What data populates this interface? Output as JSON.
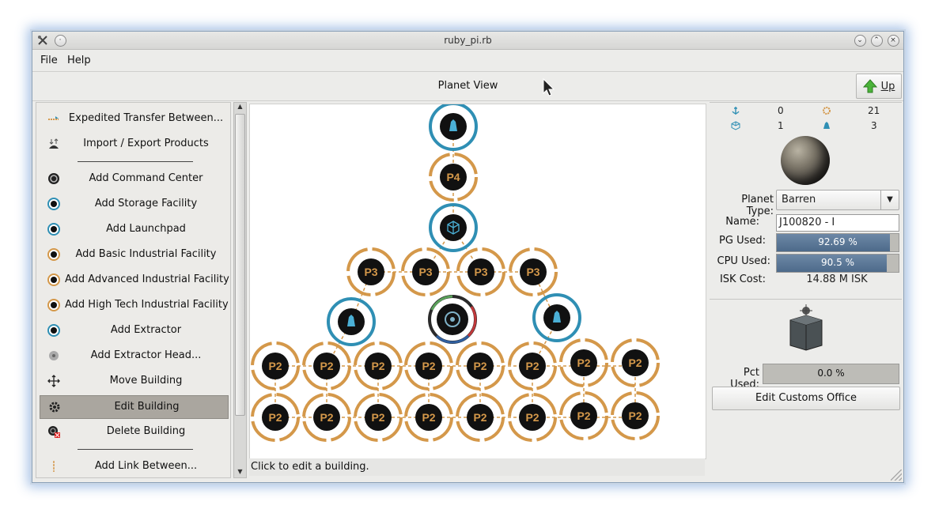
{
  "window": {
    "title": "ruby_pi.rb"
  },
  "menu": {
    "file": "File",
    "help": "Help"
  },
  "view": {
    "title": "Planet View",
    "up_label": "Up"
  },
  "tools": [
    {
      "label": "Expedited Transfer Between...",
      "icon": "transfer-icon"
    },
    {
      "label": "Import / Export Products",
      "icon": "import-export-icon"
    },
    {
      "label": "Add Command Center",
      "icon": "command-center-icon"
    },
    {
      "label": "Add Storage Facility",
      "icon": "storage-icon"
    },
    {
      "label": "Add Launchpad",
      "icon": "launchpad-icon"
    },
    {
      "label": "Add Basic Industrial Facility",
      "icon": "basic-industry-icon"
    },
    {
      "label": "Add Advanced Industrial Facility",
      "icon": "advanced-industry-icon"
    },
    {
      "label": "Add High Tech Industrial Facility",
      "icon": "hightech-industry-icon"
    },
    {
      "label": "Add Extractor",
      "icon": "extractor-icon"
    },
    {
      "label": "Add Extractor Head...",
      "icon": "extractor-head-icon"
    },
    {
      "label": "Move Building",
      "icon": "move-icon"
    },
    {
      "label": "Edit Building",
      "icon": "edit-gear-icon"
    },
    {
      "label": "Delete Building",
      "icon": "delete-icon"
    },
    {
      "label": "Add Link Between...",
      "icon": "link-icon"
    }
  ],
  "status_text": "Click to edit a building.",
  "stats": {
    "launchpads": "0",
    "factories": "21",
    "storage": "1",
    "extractors": "3"
  },
  "planet": {
    "type_label": "Planet Type:",
    "type_value": "Barren",
    "name_label": "Name:",
    "name_value": "J100820 - I",
    "pg_label": "PG Used:",
    "pg_value": "92.69 %",
    "pg_fraction": 0.9269,
    "cpu_label": "CPU Used:",
    "cpu_value": "90.5 %",
    "cpu_fraction": 0.905,
    "isk_label": "ISK Cost:",
    "isk_value": "14.88 M ISK"
  },
  "customs": {
    "pct_label": "Pct Used:",
    "pct_value": "0.0 %",
    "button": "Edit Customs Office"
  },
  "buildings": {
    "top_launchpad": "",
    "p4": "P4",
    "storage": "",
    "p3_row": [
      "P3",
      "P3",
      "P3",
      "P3"
    ],
    "left_launchpad": "",
    "command_center": "",
    "right_launchpad": "",
    "p2_row1": [
      "P2",
      "P2",
      "P2",
      "P2",
      "P2",
      "P2",
      "P2",
      "P2"
    ],
    "p2_row2": [
      "P2",
      "P2",
      "P2",
      "P2",
      "P2",
      "P2",
      "P2",
      "P2"
    ]
  },
  "colors": {
    "orange": "#d4984a",
    "blue": "#2f8fb4",
    "selection": "#aaa69f",
    "bar": "#5a7797"
  }
}
